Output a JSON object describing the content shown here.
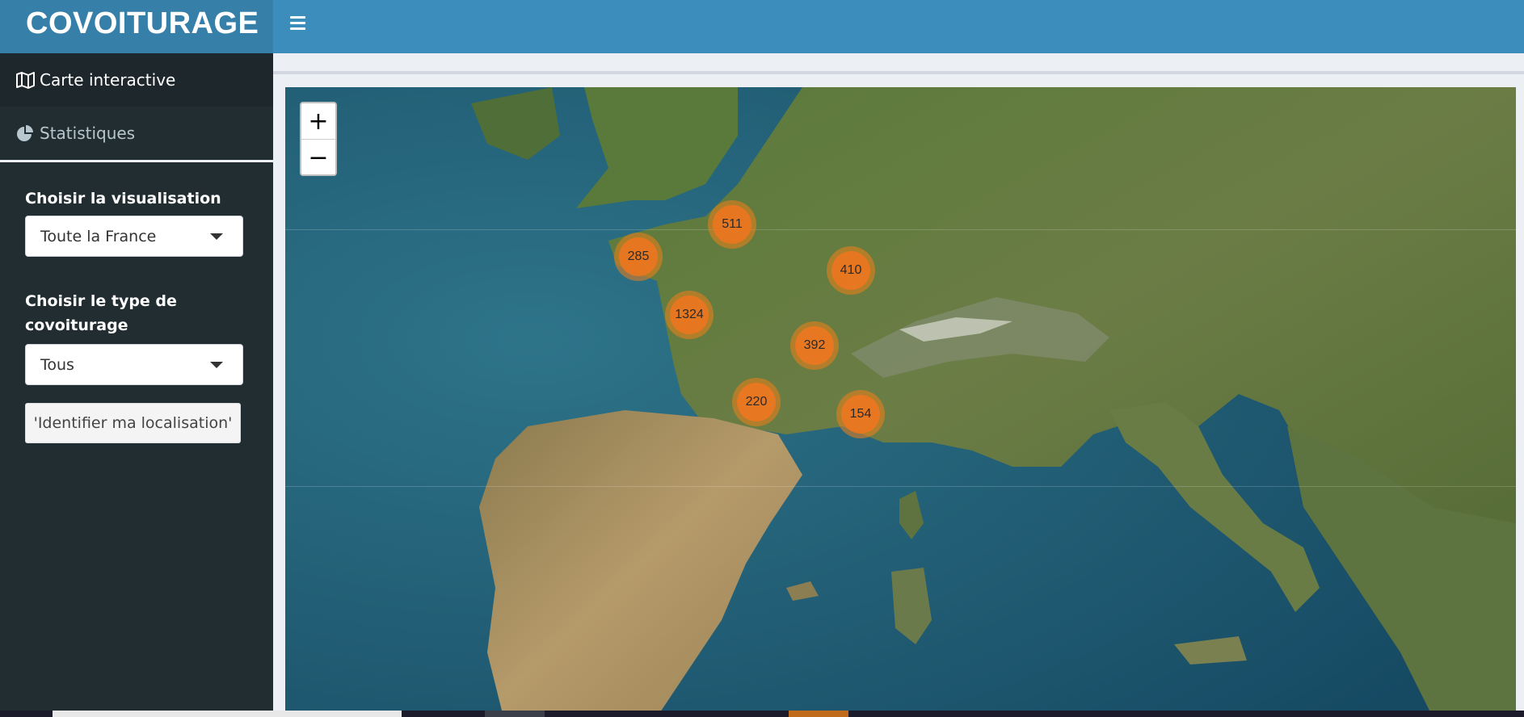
{
  "app": {
    "title": "COVOITURAGE"
  },
  "sidebar": {
    "menu": [
      {
        "label": "Carte interactive",
        "icon": "map-icon",
        "active": true
      },
      {
        "label": "Statistiques",
        "icon": "pie-chart-icon",
        "active": false
      }
    ],
    "visualisation": {
      "label": "Choisir la visualisation",
      "selected": "Toute la France"
    },
    "type": {
      "label_line1": "Choisir le type de",
      "label_line2": "covoiturage",
      "selected": "Tous"
    },
    "locate_button": "'Identifier ma localisation'"
  },
  "map": {
    "zoom_in": "+",
    "zoom_out": "−",
    "clusters": [
      {
        "id": "c511",
        "count": "511"
      },
      {
        "id": "c285",
        "count": "285"
      },
      {
        "id": "c410",
        "count": "410"
      },
      {
        "id": "c1324",
        "count": "1324"
      },
      {
        "id": "c392",
        "count": "392"
      },
      {
        "id": "c220",
        "count": "220"
      },
      {
        "id": "c154",
        "count": "154"
      }
    ]
  },
  "colors": {
    "header": "#3c8dbc",
    "logo_bg": "#367fa9",
    "sidebar_bg": "#222d32",
    "cluster": "#f0761e"
  }
}
